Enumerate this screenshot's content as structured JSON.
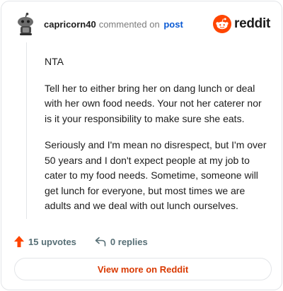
{
  "comment": {
    "username": "capricorn40",
    "action_text": "commented on",
    "post_link": "post",
    "paragraphs": [
      "NTA",
      "Tell her to either bring her on dang lunch or deal with her own food needs. Your not her caterer nor is it your responsibility to make sure she eats.",
      "Seriously and I'm mean no disrespect, but I'm over 50 years and I don't expect people at my job to cater to my food needs. Sometime, someone will get lunch for everyone, but most times we are adults and we deal with out lunch ourselves."
    ]
  },
  "brand": {
    "name": "reddit",
    "icon": "reddit-snoo-icon",
    "color": "#ff4500"
  },
  "stats": {
    "upvotes": "15 upvotes",
    "replies": "0 replies",
    "upvote_icon": "upvote-arrow-icon",
    "reply_icon": "reply-arrow-icon",
    "upvote_color": "#ff4500"
  },
  "view_more_label": "View more on Reddit"
}
